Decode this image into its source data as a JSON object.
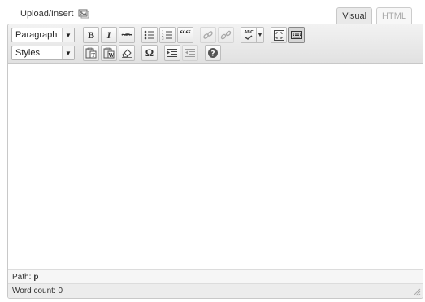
{
  "header": {
    "upload_label": "Upload/Insert",
    "tabs": [
      {
        "label": "Visual",
        "active": true
      },
      {
        "label": "HTML",
        "active": false
      }
    ]
  },
  "toolbar": {
    "format_select": "Paragraph",
    "styles_select": "Styles",
    "row1": [
      {
        "name": "bold",
        "glyph": "B"
      },
      {
        "name": "italic",
        "glyph": "I"
      },
      {
        "name": "strikethrough",
        "glyph": "ABC"
      },
      {
        "name": "bullet-list"
      },
      {
        "name": "numbered-list"
      },
      {
        "name": "blockquote",
        "glyph": "““"
      },
      {
        "name": "insert-link",
        "disabled": true
      },
      {
        "name": "unlink",
        "disabled": true
      },
      {
        "name": "spellcheck",
        "glyph": "ABC"
      },
      {
        "name": "fullscreen"
      },
      {
        "name": "kitchen-sink",
        "active": true
      }
    ],
    "row2": [
      {
        "name": "paste-text",
        "glyph": "T"
      },
      {
        "name": "paste-word",
        "glyph": "W"
      },
      {
        "name": "remove-format"
      },
      {
        "name": "special-char",
        "glyph": "Ω"
      },
      {
        "name": "indent"
      },
      {
        "name": "outdent",
        "disabled": true
      },
      {
        "name": "help",
        "glyph": "?"
      }
    ]
  },
  "editor": {
    "path_label": "Path:",
    "path_value": "p",
    "word_count": "Word count: 0"
  }
}
